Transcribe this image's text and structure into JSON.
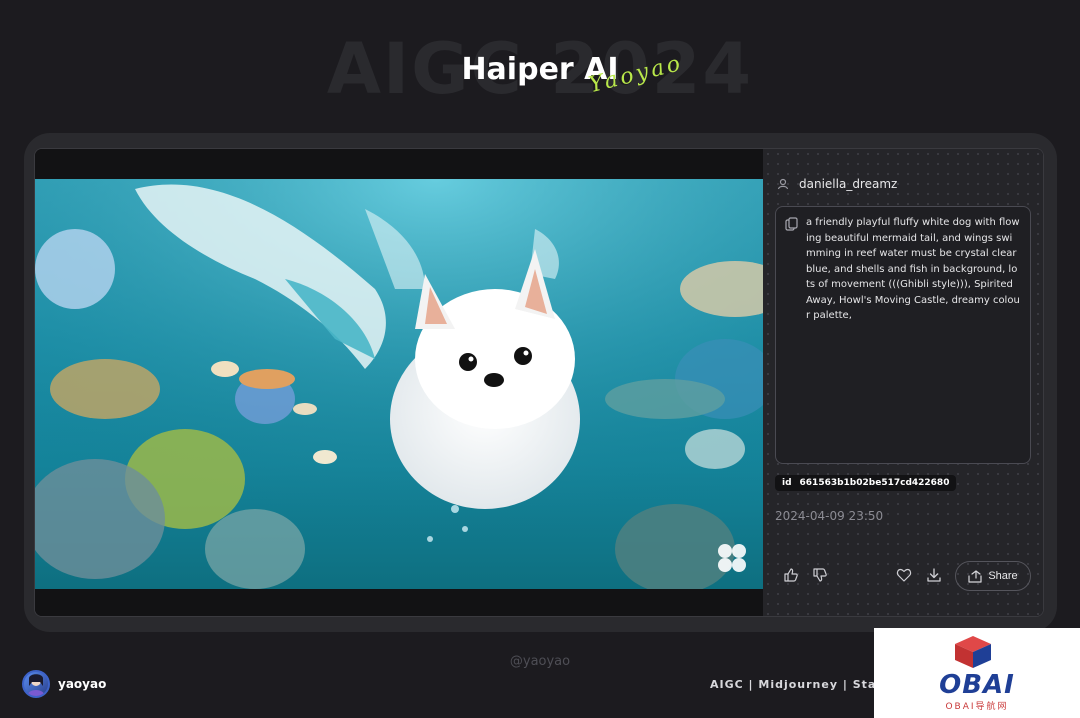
{
  "header": {
    "background_title": "AIGC 2024",
    "title": "Haiper AI",
    "signature": "Yaoyao"
  },
  "panel": {
    "username": "daniella_dreamz",
    "prompt": "a friendly playful fluffy white dog with flowing beautiful mermaid tail, and wings swimming in reef water must be crystal clear blue, and shells and fish in background, lots of movement (((Ghibli style))), Spirited Away, Howl's Moving Castle, dreamy colour palette,",
    "id_label": "id",
    "id_value": "661563b1b02be517cd422680",
    "timestamp": "2024-04-09 23:50",
    "share_label": "Share",
    "icons": [
      "user-icon",
      "copy-icon",
      "thumbs-up-icon",
      "thumbs-down-icon",
      "heart-icon",
      "download-icon",
      "share-icon"
    ]
  },
  "footer": {
    "handle": "@yaoyao",
    "username": "yaoyao",
    "tags": "AIGC | Midjourney | Stab"
  },
  "watermark": {
    "text": "OBAI",
    "subtext": "OBAI导航网"
  },
  "colors": {
    "background": "#1c1b1f",
    "accent_signature": "#b9e84a",
    "watermark_blue": "#1f3f96",
    "watermark_red": "#d94040"
  }
}
